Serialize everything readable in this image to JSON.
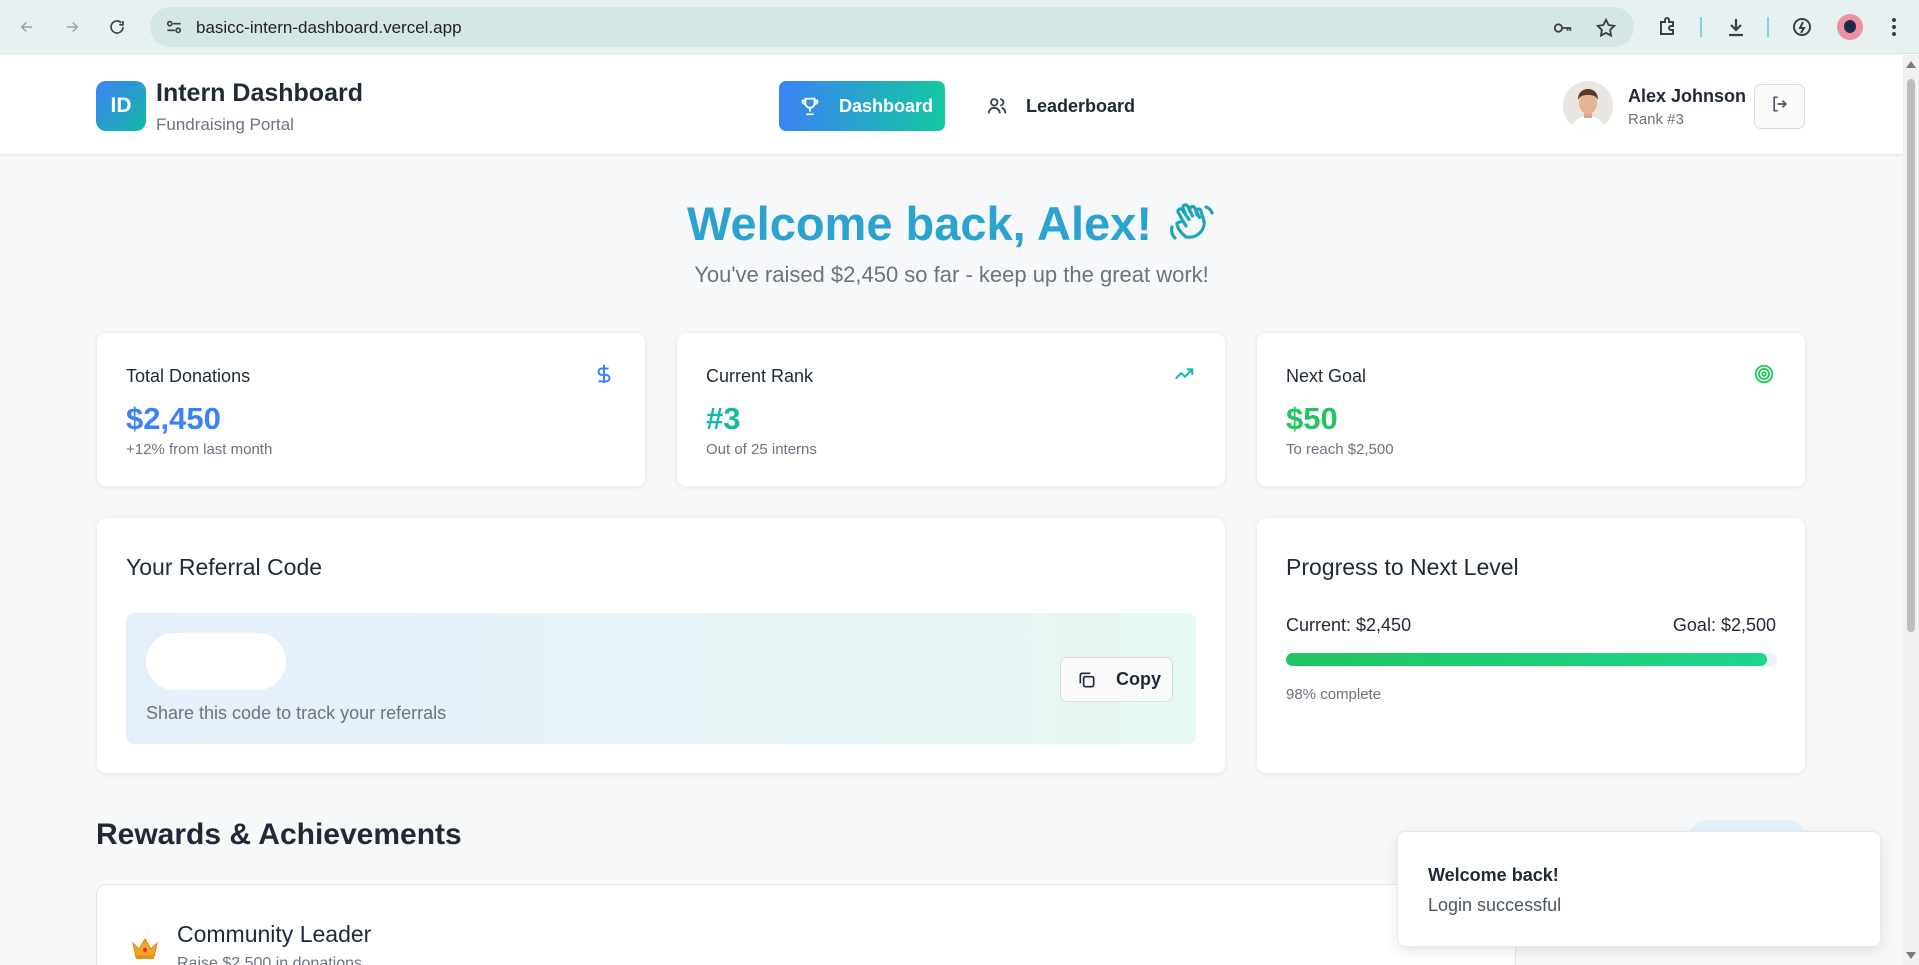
{
  "browser": {
    "url": "basicc-intern-dashboard.vercel.app"
  },
  "header": {
    "logo_text": "ID",
    "title": "Intern Dashboard",
    "subtitle": "Fundraising Portal",
    "nav": [
      {
        "label": "Dashboard",
        "icon": "trophy-icon",
        "active": true
      },
      {
        "label": "Leaderboard",
        "icon": "users-icon",
        "active": false
      }
    ],
    "user": {
      "name": "Alex Johnson",
      "rank": "Rank #3"
    }
  },
  "welcome": {
    "title": "Welcome back, Alex!",
    "subtitle": "You've raised $2,450 so far - keep up the great work!"
  },
  "stats": [
    {
      "label": "Total Donations",
      "value": "$2,450",
      "note": "+12% from last month",
      "icon": "dollar-icon",
      "color": "#3b82f6"
    },
    {
      "label": "Current Rank",
      "value": "#3",
      "note": "Out of 25 interns",
      "icon": "trending-up-icon",
      "color": "#14b8a6"
    },
    {
      "label": "Next Goal",
      "value": "$50",
      "note": "To reach $2,500",
      "icon": "target-icon",
      "color": "#22c55e"
    }
  ],
  "referral": {
    "title": "Your Referral Code",
    "code": "",
    "hint": "Share this code to track your referrals",
    "copy_label": "Copy"
  },
  "progress": {
    "title": "Progress to Next Level",
    "current_label": "Current: $2,450",
    "goal_label": "Goal: $2,500",
    "percent": 98,
    "note": "98% complete"
  },
  "rewards": {
    "title": "Rewards & Achievements",
    "items": [
      {
        "title": "Community Leader",
        "description": "Raise $2,500 in donations",
        "icon": "crown-icon"
      }
    ]
  },
  "toast": {
    "title": "Welcome back!",
    "message": "Login successful"
  }
}
